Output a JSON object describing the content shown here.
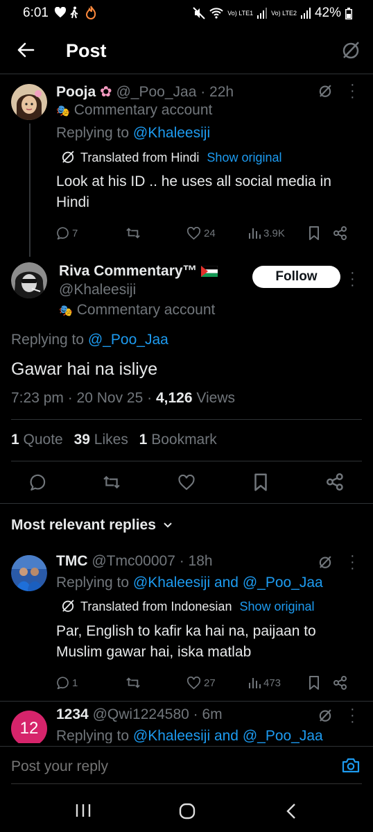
{
  "status_bar": {
    "time": "6:01",
    "battery": "42%",
    "net1": "Vo) LTE1",
    "net2": "Vo) LTE2"
  },
  "header": {
    "title": "Post"
  },
  "reply1": {
    "name": "Pooja",
    "handle": "@_Poo_Jaa",
    "time": "· 22h",
    "badge": "Commentary account",
    "replying_prefix": "Replying to",
    "replying_to": "@Khaleesiji",
    "translated": "Translated from Hindi",
    "show_original": "Show original",
    "text": "Look at his ID .. he uses all social media in Hindi",
    "replies": "7",
    "likes": "24",
    "views": "3.9K"
  },
  "main_post": {
    "name": "Riva Commentary™",
    "handle": "@Khaleesiji",
    "badge": "Commentary account",
    "follow": "Follow",
    "replying_prefix": "Replying to",
    "replying_to": "@_Poo_Jaa",
    "text": "Gawar hai na isliye",
    "timestamp": "7:23 pm · 20 Nov 25 ·",
    "views_count": "4,126",
    "views_label": "Views",
    "quotes_count": "1",
    "quotes_label": "Quote",
    "likes_count": "39",
    "likes_label": "Likes",
    "bookmarks_count": "1",
    "bookmarks_label": "Bookmark"
  },
  "sort": {
    "label": "Most relevant replies"
  },
  "reply2": {
    "name": "TMC",
    "handle": "@Tmc00007",
    "time": "· 18h",
    "replying_prefix": "Replying to",
    "replying_to": "@Khaleesiji and @_Poo_Jaa",
    "translated": "Translated from Indonesian",
    "show_original": "Show original",
    "text": "Par, English to kafir ka hai na, paijaan to Muslim gawar hai, iska matlab",
    "replies": "1",
    "likes": "27",
    "views": "473"
  },
  "reply3": {
    "avatar_text": "12",
    "name": "1234",
    "handle": "@Qwi1224580",
    "time": "· 6m",
    "replying_prefix": "Replying to",
    "replying_to": "@Khaleesiji and @_Poo_Jaa"
  },
  "reply_input": {
    "placeholder": "Post your reply"
  },
  "colors": {
    "accent": "#1d9bf0",
    "muted": "#71767b",
    "bg": "#000000",
    "avatar3": "#d6246b"
  }
}
